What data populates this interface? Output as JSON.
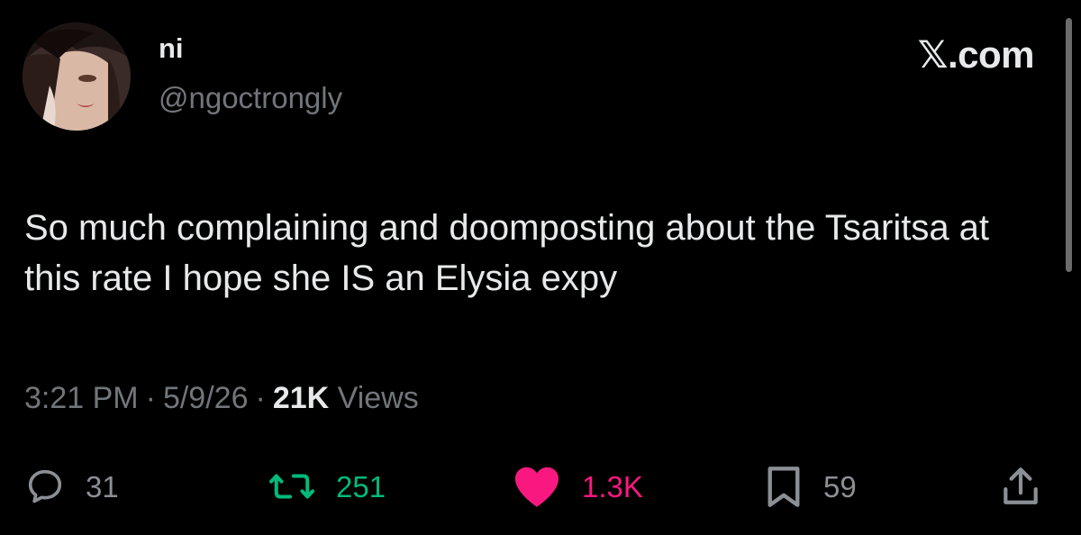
{
  "author": {
    "display_name": "ni",
    "handle": "@ngoctrongly"
  },
  "brand": "𝕏.com",
  "tweet": {
    "text": "So much complaining and doomposting about the Tsaritsa at this rate I hope she IS an Elysia expy",
    "time": "3:21 PM",
    "separator": "·",
    "date": "5/9/26",
    "views_count": "21K",
    "views_label": "Views"
  },
  "actions": {
    "replies": "31",
    "reposts": "251",
    "likes": "1.3K",
    "bookmarks": "59"
  },
  "colors": {
    "background": "#000000",
    "primary_text": "#e7e9ea",
    "secondary_text": "#71767b",
    "repost_active": "#00ba7c",
    "like_active": "#f91880"
  },
  "icons": {
    "reply": "reply-icon",
    "repost": "repost-icon",
    "like": "heart-icon",
    "bookmark": "bookmark-icon",
    "share": "share-icon"
  }
}
